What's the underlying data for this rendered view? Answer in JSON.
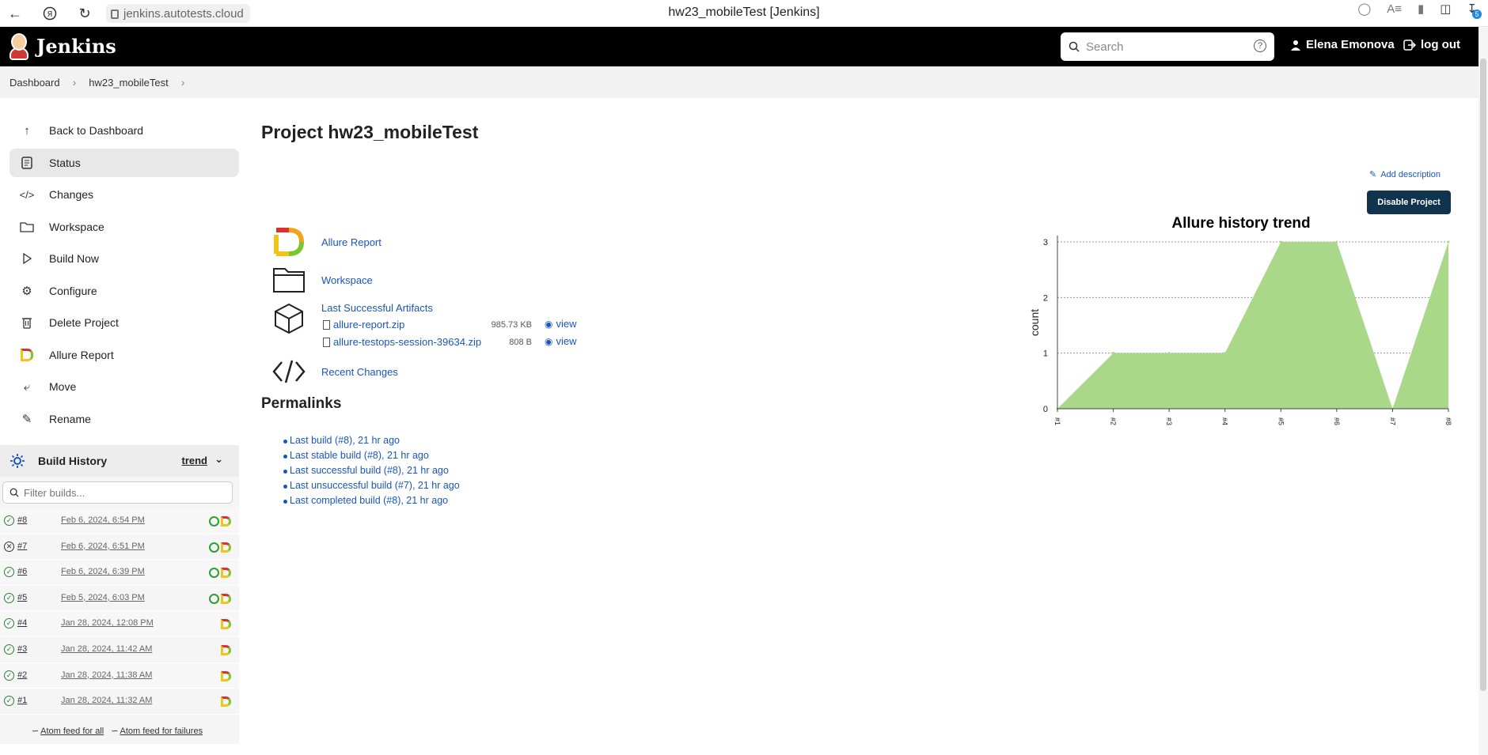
{
  "browser": {
    "url": "jenkins.autotests.cloud",
    "page_title": "hw23_mobileTest [Jenkins]",
    "downloads_count": "5"
  },
  "header": {
    "brand": "Jenkins",
    "search_placeholder": "Search",
    "help": "?",
    "user": "Elena Emonova",
    "logout": "log out"
  },
  "breadcrumb": [
    "Dashboard",
    "hw23_mobileTest"
  ],
  "sidebar": {
    "items": [
      {
        "label": "Back to Dashboard",
        "icon": "arrow-up-icon"
      },
      {
        "label": "Status",
        "icon": "document-icon"
      },
      {
        "label": "Changes",
        "icon": "code-icon"
      },
      {
        "label": "Workspace",
        "icon": "folder-icon"
      },
      {
        "label": "Build Now",
        "icon": "play-icon"
      },
      {
        "label": "Configure",
        "icon": "gear-icon"
      },
      {
        "label": "Delete Project",
        "icon": "trash-icon"
      },
      {
        "label": "Allure Report",
        "icon": "allure-icon"
      },
      {
        "label": "Move",
        "icon": "move-icon"
      },
      {
        "label": "Rename",
        "icon": "pencil-icon"
      }
    ]
  },
  "build_history": {
    "title": "Build History",
    "trend": "trend",
    "filter_placeholder": "Filter builds...",
    "builds": [
      {
        "num": "#8",
        "date": "Feb 6, 2024, 6:54 PM",
        "status": "success",
        "allure_green": true
      },
      {
        "num": "#7",
        "date": "Feb 6, 2024, 6:51 PM",
        "status": "failed",
        "allure_green": true
      },
      {
        "num": "#6",
        "date": "Feb 6, 2024, 6:39 PM",
        "status": "success",
        "allure_green": true
      },
      {
        "num": "#5",
        "date": "Feb 5, 2024, 6:03 PM",
        "status": "success",
        "allure_green": true
      },
      {
        "num": "#4",
        "date": "Jan 28, 2024, 12:08 PM",
        "status": "success",
        "allure_green": false
      },
      {
        "num": "#3",
        "date": "Jan 28, 2024, 11:42 AM",
        "status": "success",
        "allure_green": false
      },
      {
        "num": "#2",
        "date": "Jan 28, 2024, 11:38 AM",
        "status": "success",
        "allure_green": false
      },
      {
        "num": "#1",
        "date": "Jan 28, 2024, 11:32 AM",
        "status": "success",
        "allure_green": false
      }
    ],
    "feed_all": "Atom feed for all",
    "feed_failures": "Atom feed for failures"
  },
  "main": {
    "title": "Project hw23_mobileTest",
    "add_description": "Add description",
    "disable_project": "Disable Project",
    "links": {
      "allure_report": "Allure Report",
      "workspace": "Workspace",
      "last_artifacts": "Last Successful Artifacts",
      "recent_changes": "Recent Changes"
    },
    "artifacts": [
      {
        "name": "allure-report.zip",
        "size": "985.73 KB",
        "view": "view"
      },
      {
        "name": "allure-testops-session-39634.zip",
        "size": "808 B",
        "view": "view"
      }
    ],
    "permalinks_title": "Permalinks",
    "permalinks": [
      "Last build (#8), 21 hr ago",
      "Last stable build (#8), 21 hr ago",
      "Last successful build (#8), 21 hr ago",
      "Last unsuccessful build (#7), 21 hr ago",
      "Last completed build (#8), 21 hr ago"
    ]
  },
  "chart_data": {
    "type": "area",
    "title": "Allure history trend",
    "ylabel": "count",
    "xlabel": "",
    "categories": [
      "#1",
      "#2",
      "#3",
      "#4",
      "#5",
      "#6",
      "#7",
      "#8"
    ],
    "series": [
      {
        "values": [
          0,
          1,
          1,
          1,
          3,
          3,
          0,
          3
        ],
        "color": "#a9d889"
      }
    ],
    "ylim": [
      0,
      3
    ],
    "yticks": [
      0,
      1,
      2,
      3
    ],
    "grid": true
  }
}
